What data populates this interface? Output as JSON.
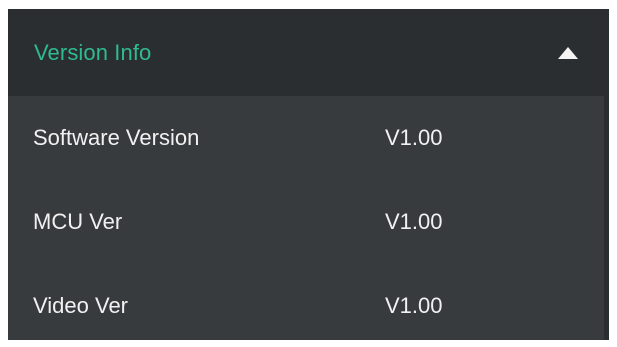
{
  "section": {
    "title": "Version Info",
    "collapse_icon": "triangle-up-icon",
    "rows": [
      {
        "label": "Software Version",
        "value": "V1.00"
      },
      {
        "label": "MCU Ver",
        "value": "V1.00"
      },
      {
        "label": "Video Ver",
        "value": "V1.00"
      }
    ]
  },
  "colors": {
    "header_text": "#2fba8f",
    "header_bg": "#2b2e30",
    "panel_bg": "#383b3d",
    "text": "#f1f1f1"
  }
}
